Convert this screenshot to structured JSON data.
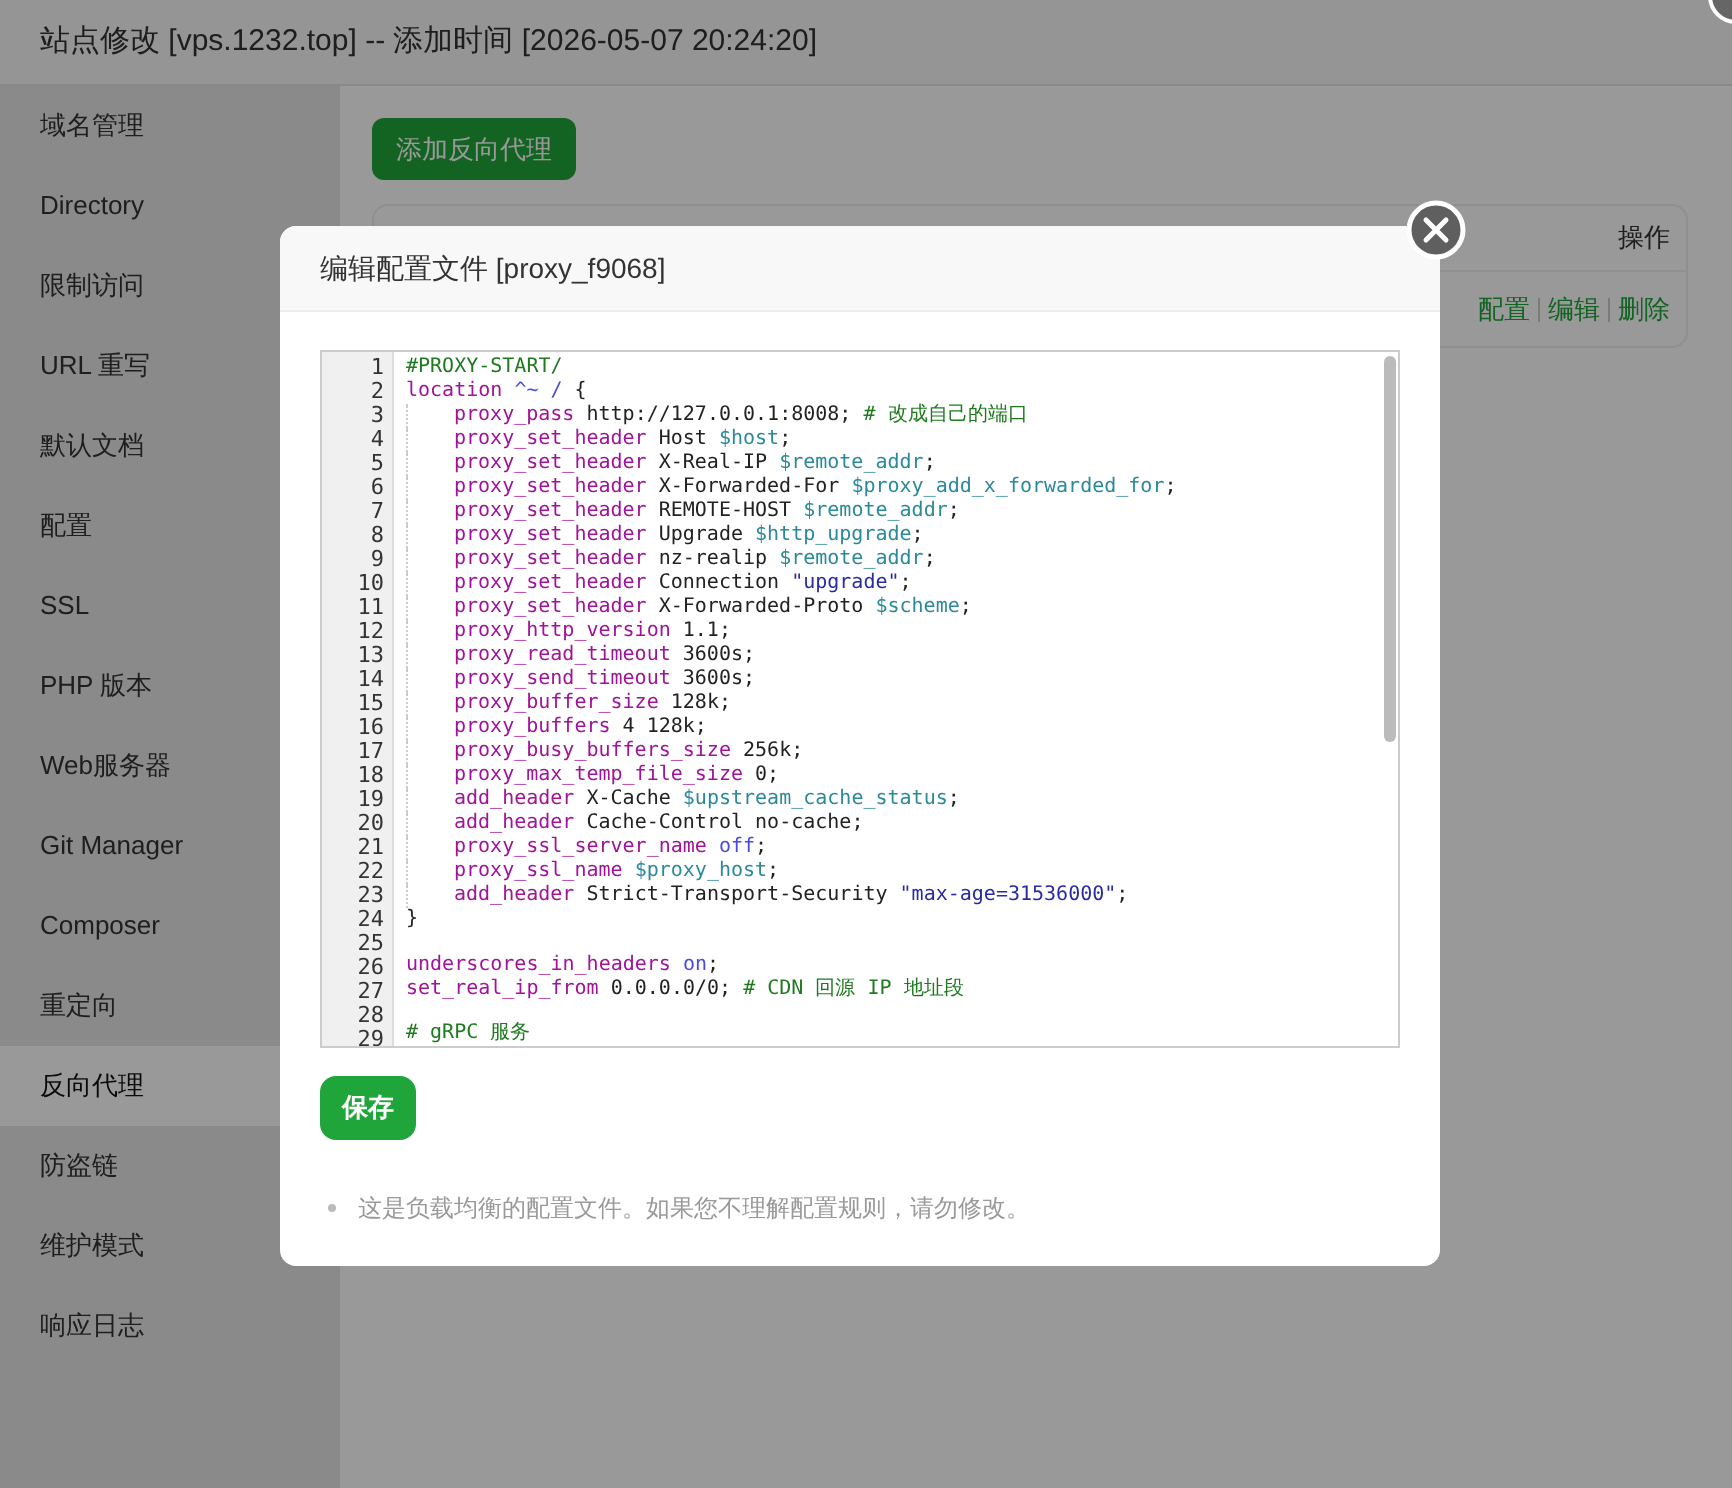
{
  "window": {
    "title": "站点修改 [vps.1232.top] -- 添加时间 [2026-05-07 20:24:20]"
  },
  "sidebar": {
    "items": [
      {
        "label": "域名管理",
        "selected": false
      },
      {
        "label": "Directory",
        "selected": false
      },
      {
        "label": "限制访问",
        "selected": false
      },
      {
        "label": "URL 重写",
        "selected": false
      },
      {
        "label": "默认文档",
        "selected": false
      },
      {
        "label": "配置",
        "selected": false
      },
      {
        "label": "SSL",
        "selected": false
      },
      {
        "label": "PHP 版本",
        "selected": false
      },
      {
        "label": "Web服务器",
        "selected": false
      },
      {
        "label": "Git Manager",
        "selected": false
      },
      {
        "label": "Composer",
        "selected": false
      },
      {
        "label": "重定向",
        "selected": false
      },
      {
        "label": "反向代理",
        "selected": true
      },
      {
        "label": "防盗链",
        "selected": false
      },
      {
        "label": "维护模式",
        "selected": false
      },
      {
        "label": "响应日志",
        "selected": false
      }
    ]
  },
  "content": {
    "add_button": "添加反向代理",
    "table": {
      "columns": [
        "操作"
      ],
      "rows": [
        {
          "actions": [
            "配置",
            "编辑",
            "删除"
          ]
        }
      ]
    }
  },
  "dialog": {
    "title": "编辑配置文件 [proxy_f9068]",
    "lines": [
      {
        "number": "1",
        "indented": false,
        "tokens": [
          {
            "kind": "comment",
            "text": "#PROXY-START/"
          }
        ]
      },
      {
        "number": "2",
        "indented": false,
        "tokens": [
          {
            "kind": "keyword",
            "text": "location"
          },
          {
            "kind": "atom",
            "text": " ^~ /"
          },
          {
            "kind": "plain",
            "text": " {"
          }
        ]
      },
      {
        "number": "3",
        "indented": true,
        "tokens": [
          {
            "kind": "keyword",
            "text": "proxy_pass"
          },
          {
            "kind": "plain",
            "text": " http://127.0.0.1:8008; "
          },
          {
            "kind": "comment",
            "text": "# 改成自己的端口"
          }
        ]
      },
      {
        "number": "4",
        "indented": true,
        "tokens": [
          {
            "kind": "keyword",
            "text": "proxy_set_header"
          },
          {
            "kind": "plain",
            "text": " Host "
          },
          {
            "kind": "variable",
            "text": "$host"
          },
          {
            "kind": "plain",
            "text": ";"
          }
        ]
      },
      {
        "number": "5",
        "indented": true,
        "tokens": [
          {
            "kind": "keyword",
            "text": "proxy_set_header"
          },
          {
            "kind": "plain",
            "text": " X-Real-IP "
          },
          {
            "kind": "variable",
            "text": "$remote_addr"
          },
          {
            "kind": "plain",
            "text": ";"
          }
        ]
      },
      {
        "number": "6",
        "indented": true,
        "tokens": [
          {
            "kind": "keyword",
            "text": "proxy_set_header"
          },
          {
            "kind": "plain",
            "text": " X-Forwarded-For "
          },
          {
            "kind": "variable",
            "text": "$proxy_add_x_forwarded_for"
          },
          {
            "kind": "plain",
            "text": ";"
          }
        ]
      },
      {
        "number": "7",
        "indented": true,
        "tokens": [
          {
            "kind": "keyword",
            "text": "proxy_set_header"
          },
          {
            "kind": "plain",
            "text": " REMOTE-HOST "
          },
          {
            "kind": "variable",
            "text": "$remote_addr"
          },
          {
            "kind": "plain",
            "text": ";"
          }
        ]
      },
      {
        "number": "8",
        "indented": true,
        "tokens": [
          {
            "kind": "keyword",
            "text": "proxy_set_header"
          },
          {
            "kind": "plain",
            "text": " Upgrade "
          },
          {
            "kind": "variable",
            "text": "$http_upgrade"
          },
          {
            "kind": "plain",
            "text": ";"
          }
        ]
      },
      {
        "number": "9",
        "indented": true,
        "tokens": [
          {
            "kind": "keyword",
            "text": "proxy_set_header"
          },
          {
            "kind": "plain",
            "text": " nz-realip "
          },
          {
            "kind": "variable",
            "text": "$remote_addr"
          },
          {
            "kind": "plain",
            "text": ";"
          }
        ]
      },
      {
        "number": "10",
        "indented": true,
        "tokens": [
          {
            "kind": "keyword",
            "text": "proxy_set_header"
          },
          {
            "kind": "plain",
            "text": " Connection "
          },
          {
            "kind": "string",
            "text": "\"upgrade\""
          },
          {
            "kind": "plain",
            "text": ";"
          }
        ]
      },
      {
        "number": "11",
        "indented": true,
        "tokens": [
          {
            "kind": "keyword",
            "text": "proxy_set_header"
          },
          {
            "kind": "plain",
            "text": " X-Forwarded-Proto "
          },
          {
            "kind": "variable",
            "text": "$scheme"
          },
          {
            "kind": "plain",
            "text": ";"
          }
        ]
      },
      {
        "number": "12",
        "indented": true,
        "tokens": [
          {
            "kind": "keyword",
            "text": "proxy_http_version"
          },
          {
            "kind": "plain",
            "text": " 1.1;"
          }
        ]
      },
      {
        "number": "13",
        "indented": true,
        "tokens": [
          {
            "kind": "keyword",
            "text": "proxy_read_timeout"
          },
          {
            "kind": "plain",
            "text": " 3600s;"
          }
        ]
      },
      {
        "number": "14",
        "indented": true,
        "tokens": [
          {
            "kind": "keyword",
            "text": "proxy_send_timeout"
          },
          {
            "kind": "plain",
            "text": " 3600s;"
          }
        ]
      },
      {
        "number": "15",
        "indented": true,
        "tokens": [
          {
            "kind": "keyword",
            "text": "proxy_buffer_size"
          },
          {
            "kind": "plain",
            "text": " 128k;"
          }
        ]
      },
      {
        "number": "16",
        "indented": true,
        "tokens": [
          {
            "kind": "keyword",
            "text": "proxy_buffers"
          },
          {
            "kind": "plain",
            "text": " 4 128k;"
          }
        ]
      },
      {
        "number": "17",
        "indented": true,
        "tokens": [
          {
            "kind": "keyword",
            "text": "proxy_busy_buffers_size"
          },
          {
            "kind": "plain",
            "text": " 256k;"
          }
        ]
      },
      {
        "number": "18",
        "indented": true,
        "tokens": [
          {
            "kind": "keyword",
            "text": "proxy_max_temp_file_size"
          },
          {
            "kind": "plain",
            "text": " 0;"
          }
        ]
      },
      {
        "number": "19",
        "indented": true,
        "tokens": [
          {
            "kind": "keyword",
            "text": "add_header"
          },
          {
            "kind": "plain",
            "text": " X-Cache "
          },
          {
            "kind": "variable",
            "text": "$upstream_cache_status"
          },
          {
            "kind": "plain",
            "text": ";"
          }
        ]
      },
      {
        "number": "20",
        "indented": true,
        "tokens": [
          {
            "kind": "keyword",
            "text": "add_header"
          },
          {
            "kind": "plain",
            "text": " Cache-Control no-cache;"
          }
        ]
      },
      {
        "number": "21",
        "indented": true,
        "tokens": [
          {
            "kind": "keyword",
            "text": "proxy_ssl_server_name"
          },
          {
            "kind": "atom",
            "text": " off"
          },
          {
            "kind": "plain",
            "text": ";"
          }
        ]
      },
      {
        "number": "22",
        "indented": true,
        "tokens": [
          {
            "kind": "keyword",
            "text": "proxy_ssl_name"
          },
          {
            "kind": "variable",
            "text": " $proxy_host"
          },
          {
            "kind": "plain",
            "text": ";"
          }
        ]
      },
      {
        "number": "23",
        "indented": true,
        "tokens": [
          {
            "kind": "keyword",
            "text": "add_header"
          },
          {
            "kind": "plain",
            "text": " Strict-Transport-Security "
          },
          {
            "kind": "string",
            "text": "\"max-age=31536000\""
          },
          {
            "kind": "plain",
            "text": ";"
          }
        ]
      },
      {
        "number": "24",
        "indented": false,
        "tokens": [
          {
            "kind": "plain",
            "text": "}"
          }
        ]
      },
      {
        "number": "25",
        "indented": false
      },
      {
        "number": "26",
        "indented": false,
        "tokens": [
          {
            "kind": "keyword",
            "text": "underscores_in_headers"
          },
          {
            "kind": "atom",
            "text": " on"
          },
          {
            "kind": "plain",
            "text": ";"
          }
        ]
      },
      {
        "number": "27",
        "indented": false,
        "tokens": [
          {
            "kind": "keyword",
            "text": "set_real_ip_from"
          },
          {
            "kind": "plain",
            "text": " 0.0.0.0/0; "
          },
          {
            "kind": "comment",
            "text": "# CDN 回源 IP 地址段"
          }
        ]
      },
      {
        "number": "28",
        "indented": false
      },
      {
        "number": "29",
        "indented": false,
        "tokens": [
          {
            "kind": "comment",
            "text": "# gRPC 服务"
          }
        ]
      }
    ],
    "save_button": "保存",
    "notes": [
      "这是负载均衡的配置文件。如果您不理解配置规则，请勿修改。"
    ]
  }
}
